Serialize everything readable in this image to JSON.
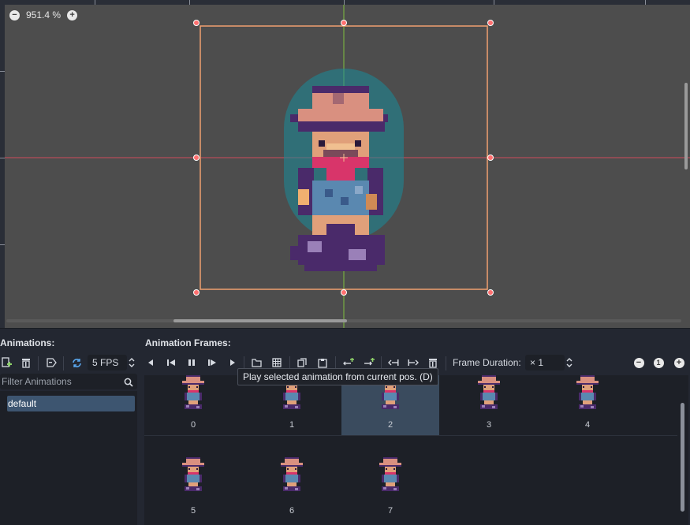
{
  "viewport": {
    "zoom_level": "951.4 %",
    "zoom_out_icon": "minus-circle-icon",
    "zoom_in_icon": "plus-circle-icon"
  },
  "animations_panel": {
    "title": "Animations:",
    "speed": "5 FPS",
    "filter_placeholder": "Filter Animations",
    "items": [
      "default"
    ],
    "selected": "default"
  },
  "frames_panel": {
    "title": "Animation Frames:",
    "frame_duration_label": "Frame Duration:",
    "frame_duration_value": "× 1",
    "frames": [
      "0",
      "1",
      "2",
      "3",
      "4",
      "5",
      "6",
      "7"
    ],
    "selected_frame": "2",
    "tooltip": "Play selected animation from current pos. (D)"
  },
  "colors": {
    "viewport_bg": "#4d4d4d",
    "panel_bg": "#232731",
    "list_bg": "#1d2027",
    "selection": "#3d5570",
    "rect_outline": "#f0a070",
    "handle": "#ff7070",
    "x_axis": "#d04a5a",
    "y_axis": "#7fbf3f",
    "collision_shape": "#1a8c9a"
  }
}
